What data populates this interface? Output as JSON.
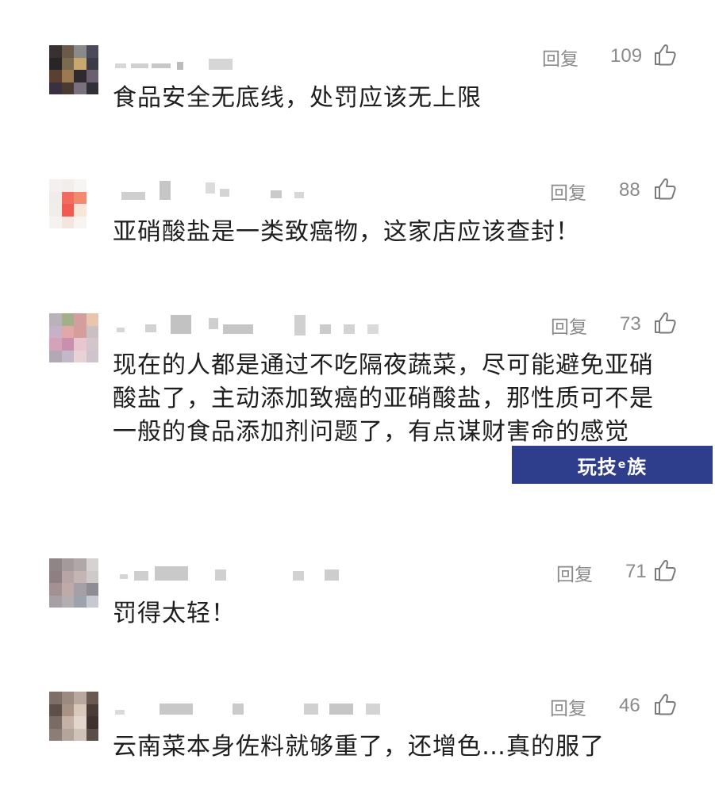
{
  "comments": [
    {
      "text": "食品安全无底线，处罚应该无上限",
      "reply_label": "回复",
      "likes": "109",
      "avatar_colors": [
        "#3a3030",
        "#6b5a4a",
        "#8a8a8a",
        "#4a4a5a",
        "#2a2525",
        "#7a6a50",
        "#c9a870",
        "#3a3a48",
        "#5a4030",
        "#9a7a50",
        "#2e2a30",
        "#6a6070",
        "#3a3040",
        "#4a3a30",
        "#7a7080",
        "#303038"
      ]
    },
    {
      "text": "亚硝酸盐是一类致癌物，这家店应该查封！",
      "reply_label": "回复",
      "likes": "88",
      "avatar_colors": [
        "#f4f0ee",
        "#f2eeec",
        "#f7f4f2",
        "#ffffff",
        "#f0ece9",
        "#f26b60",
        "#f38a70",
        "#ffffff",
        "#f1ede9",
        "#ef5a52",
        "#f8e6d8",
        "#ffffff",
        "#f5f2f0",
        "#f4e5e0",
        "#f7f4f2",
        "#ffffff"
      ]
    },
    {
      "text": "现在的人都是通过不吃隔夜蔬菜，尽可能避免亚硝酸盐了，主动添加致癌的亚硝酸盐，那性质可不是一般的食品添加剂问题了，有点谋财害命的感觉",
      "reply_label": "回复",
      "likes": "73",
      "avatar_colors": [
        "#b9b3b9",
        "#a2b08a",
        "#d49e9e",
        "#e9c5b0",
        "#c6b1c9",
        "#e2a7a9",
        "#d69d9a",
        "#c9c0c4",
        "#d3a3b9",
        "#c98fae",
        "#e7c6d0",
        "#d2c6cc",
        "#b3a8b6",
        "#c4b7c7",
        "#e8d2d6",
        "#cfc4cd"
      ]
    },
    {
      "text": "罚得太轻！",
      "reply_label": "回复",
      "likes": "71",
      "avatar_colors": [
        "#8f8587",
        "#a49a9c",
        "#b0a7a8",
        "#d6d2d2",
        "#8f7f82",
        "#b7a4a4",
        "#c2b5b4",
        "#cfc9c9",
        "#a29093",
        "#c0aaa8",
        "#a4a0a8",
        "#8e8d96",
        "#a6a0a4",
        "#b3aeb2",
        "#9ea2ad",
        "#c7c9d1"
      ]
    },
    {
      "text": "云南菜本身佐料就够重了，还增色…真的服了",
      "reply_label": "回复",
      "likes": "46",
      "avatar_colors": [
        "#7d6f68",
        "#9a8a80",
        "#b8a8a0",
        "#6a5a52",
        "#5e5048",
        "#a89284",
        "#d8c8bc",
        "#4a3c36",
        "#7a6c64",
        "#c4b0a4",
        "#e2d6cc",
        "#3e322e",
        "#8c7e76",
        "#b4a49a",
        "#d0c2b8",
        "#5a4e48"
      ]
    }
  ],
  "watermark": {
    "text_before": "玩技",
    "text_small": "e",
    "text_after": "族",
    "background": "#2f3e8c"
  },
  "colors": {
    "meta_gray": "#8a8a8a",
    "text_dark": "#1e1e1e"
  }
}
